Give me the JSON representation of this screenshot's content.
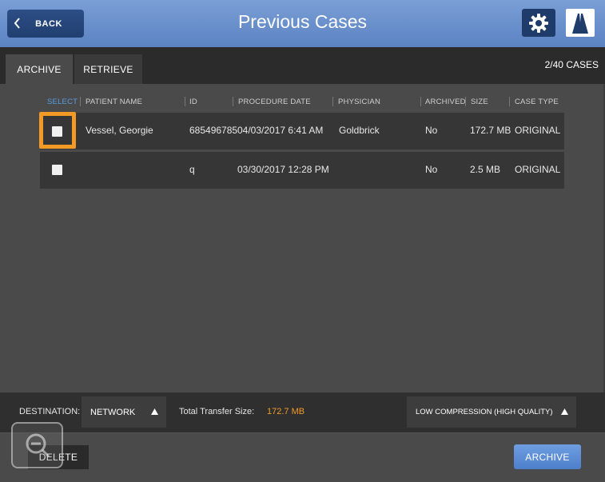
{
  "header": {
    "back_label": "BACK",
    "title": "Previous Cases"
  },
  "tabs": [
    {
      "label": "ARCHIVE",
      "active": true
    },
    {
      "label": "RETRIEVE",
      "active": false
    }
  ],
  "case_count": "2/40 CASES",
  "columns": {
    "select": "SELECT",
    "patient_name": "PATIENT NAME",
    "id": "ID",
    "procedure_date": "PROCEDURE DATE",
    "physician": "PHYSICIAN",
    "archived": "ARCHIVED",
    "size": "SIZE",
    "case_type": "CASE TYPE"
  },
  "rows": [
    {
      "patient_name": "Vessel, Georgie",
      "id": "685496785",
      "procedure_date": "04/03/2017  6:41 AM",
      "physician": "Goldbrick",
      "archived": "No",
      "size": "172.7 MB",
      "case_type": "ORIGINAL"
    },
    {
      "patient_name": "",
      "id": "q",
      "procedure_date": "03/30/2017  12:28 PM",
      "physician": "",
      "archived": "No",
      "size": "2.5 MB",
      "case_type": "ORIGINAL"
    }
  ],
  "bottom": {
    "destination_label": "DESTINATION:",
    "destination_value": "NETWORK",
    "transfer_label": "Total Transfer Size:",
    "transfer_value": "172.7 MB",
    "compression_value": "LOW COMPRESSION (HIGH QUALITY)"
  },
  "footer": {
    "delete_label": "DELETE",
    "archive_label": "ARCHIVE"
  },
  "colors": {
    "header": "#6a90cc",
    "accent_orange": "#f39a26",
    "select_blue": "#5a9be0"
  }
}
